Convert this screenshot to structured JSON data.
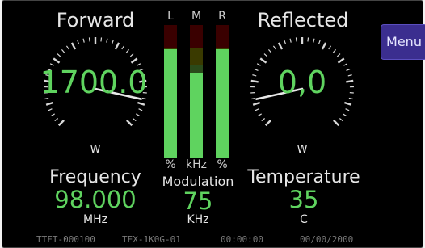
{
  "forward": {
    "title": "Forward",
    "value": "1700.0",
    "unit": "W",
    "needle_fraction": 0.88
  },
  "reflected": {
    "title": "Reflected",
    "value": "0,0",
    "unit": "W",
    "needle_fraction": 0.12
  },
  "vu": {
    "channels": [
      {
        "label": "L",
        "unit": "%",
        "level": 0.82
      },
      {
        "label": "M",
        "unit": "kHz",
        "level": 0.64
      },
      {
        "label": "R",
        "unit": "%",
        "level": 0.82
      }
    ],
    "colors": {
      "fill": "#5fd35f",
      "red_zone": "#3a0000",
      "yellow_zone": "#3a3a00",
      "green_zone": "#2a4a1a"
    }
  },
  "frequency": {
    "title": "Frequency",
    "value": "98.000",
    "unit": "MHz"
  },
  "modulation": {
    "title": "Modulation",
    "value": "75",
    "unit": "KHz"
  },
  "temperature": {
    "title": "Temperature",
    "value": "35",
    "unit": "C"
  },
  "menu": {
    "label": "Menu"
  },
  "status_bar": {
    "device_id": "TTFT-000100",
    "model": "TEX-1K0G-01",
    "time": "00:00:00",
    "date": "00/00/2000"
  },
  "colors": {
    "value_green": "#5fd35f",
    "label": "#e6e6e6",
    "background": "#000000",
    "menu_bg": "#3b2e8f"
  }
}
